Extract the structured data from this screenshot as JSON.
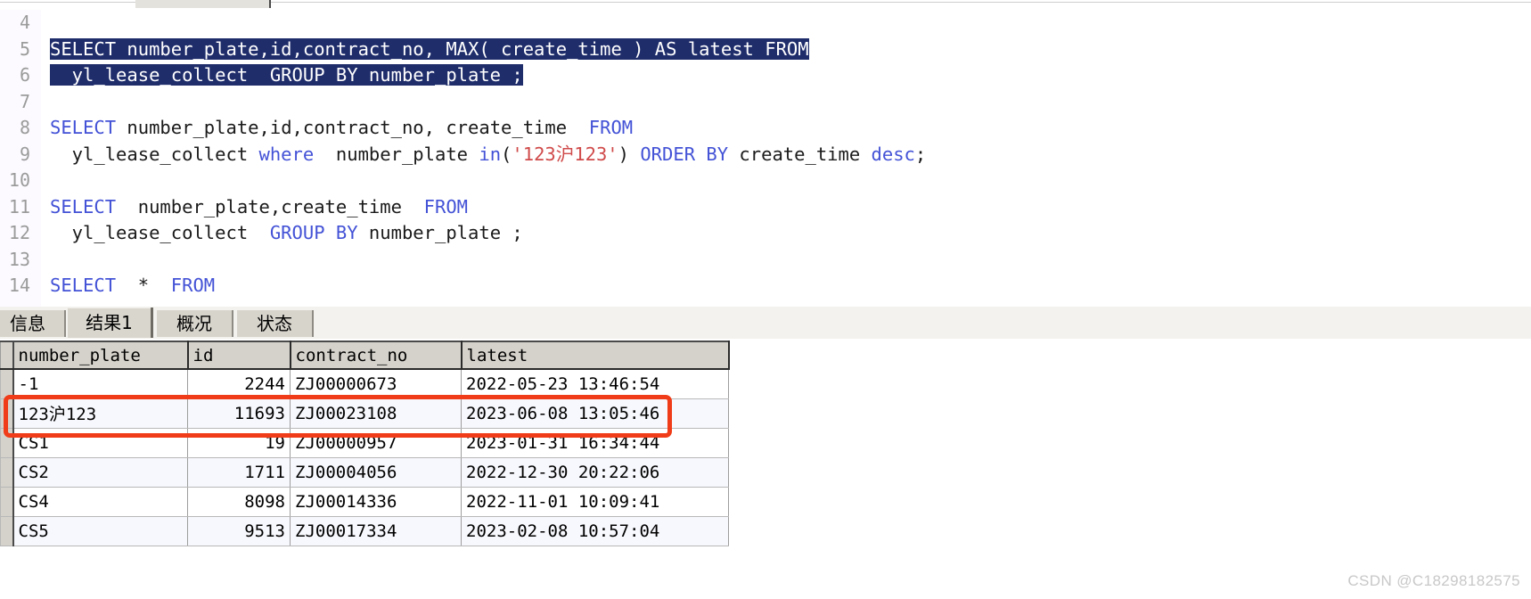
{
  "app": {
    "watermark": "CSDN @C18298182575"
  },
  "editor": {
    "lines": [
      {
        "no": "4",
        "segments": []
      },
      {
        "no": "5",
        "segments": [
          {
            "text": "SELECT number_plate,id,contract_no, MAX( create_time ) AS latest FROM",
            "style": "sel"
          }
        ]
      },
      {
        "no": "6",
        "segments": [
          {
            "text": "  yl_lease_collect  GROUP BY number_plate ;",
            "style": "sel"
          }
        ]
      },
      {
        "no": "7",
        "segments": []
      },
      {
        "no": "8",
        "segments": [
          {
            "text": "SELECT",
            "style": "kw"
          },
          {
            "text": " number_plate,id,contract_no, create_time  ",
            "style": "plain"
          },
          {
            "text": "FROM",
            "style": "kw"
          }
        ]
      },
      {
        "no": "9",
        "segments": [
          {
            "text": "  yl_lease_collect ",
            "style": "plain"
          },
          {
            "text": "where",
            "style": "kw"
          },
          {
            "text": "  number_plate ",
            "style": "plain"
          },
          {
            "text": "in",
            "style": "kw"
          },
          {
            "text": "(",
            "style": "plain"
          },
          {
            "text": "'123沪123'",
            "style": "str"
          },
          {
            "text": ") ",
            "style": "plain"
          },
          {
            "text": "ORDER BY",
            "style": "kw"
          },
          {
            "text": " create_time ",
            "style": "plain"
          },
          {
            "text": "desc",
            "style": "kw"
          },
          {
            "text": ";",
            "style": "plain"
          }
        ]
      },
      {
        "no": "10",
        "segments": []
      },
      {
        "no": "11",
        "segments": [
          {
            "text": "SELECT",
            "style": "kw"
          },
          {
            "text": "  number_plate,create_time  ",
            "style": "plain"
          },
          {
            "text": "FROM",
            "style": "kw"
          }
        ]
      },
      {
        "no": "12",
        "segments": [
          {
            "text": "  yl_lease_collect  ",
            "style": "plain"
          },
          {
            "text": "GROUP BY",
            "style": "kw"
          },
          {
            "text": " number_plate ;",
            "style": "plain"
          }
        ]
      },
      {
        "no": "13",
        "segments": []
      },
      {
        "no": "14",
        "segments": [
          {
            "text": "SELECT",
            "style": "kw"
          },
          {
            "text": "  *  ",
            "style": "plain"
          },
          {
            "text": "FROM",
            "style": "kw"
          }
        ]
      }
    ]
  },
  "tabs": [
    {
      "label": "信息",
      "active": false
    },
    {
      "label": "结果1",
      "active": true
    },
    {
      "label": "概况",
      "active": false
    },
    {
      "label": "状态",
      "active": false
    }
  ],
  "grid": {
    "columns": [
      "number_plate",
      "id",
      "contract_no",
      "latest"
    ],
    "rows": [
      {
        "number_plate": "-1",
        "id": "2244",
        "contract_no": "ZJ00000673",
        "latest": "2022-05-23 13:46:54",
        "highlighted": false
      },
      {
        "number_plate": "123沪123",
        "id": "11693",
        "contract_no": "ZJ00023108",
        "latest": "2023-06-08 13:05:46",
        "highlighted": true
      },
      {
        "number_plate": "CS1",
        "id": "19",
        "contract_no": "ZJ00000957",
        "latest": "2023-01-31 16:34:44",
        "highlighted": false
      },
      {
        "number_plate": "CS2",
        "id": "1711",
        "contract_no": "ZJ00004056",
        "latest": "2022-12-30 20:22:06",
        "highlighted": false
      },
      {
        "number_plate": "CS4",
        "id": "8098",
        "contract_no": "ZJ00014336",
        "latest": "2022-11-01 10:09:41",
        "highlighted": false
      },
      {
        "number_plate": "CS5",
        "id": "9513",
        "contract_no": "ZJ00017334",
        "latest": "2023-02-08 10:57:04",
        "highlighted": false
      }
    ]
  },
  "colors": {
    "selection": "#1f2d6b",
    "keyword": "#4352d6",
    "string": "#d04a4a",
    "highlight_rect": "#f03c18"
  }
}
